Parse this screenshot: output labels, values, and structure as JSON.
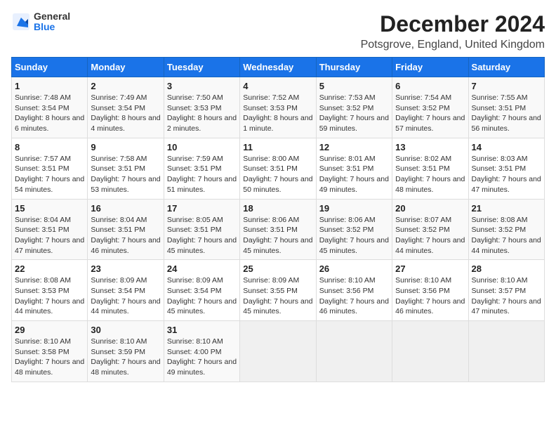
{
  "logo": {
    "general": "General",
    "blue": "Blue"
  },
  "header": {
    "title": "December 2024",
    "subtitle": "Potsgrove, England, United Kingdom"
  },
  "days_of_week": [
    "Sunday",
    "Monday",
    "Tuesday",
    "Wednesday",
    "Thursday",
    "Friday",
    "Saturday"
  ],
  "weeks": [
    [
      {
        "day": "1",
        "sunrise": "7:48 AM",
        "sunset": "3:54 PM",
        "daylight": "8 hours and 6 minutes."
      },
      {
        "day": "2",
        "sunrise": "7:49 AM",
        "sunset": "3:54 PM",
        "daylight": "8 hours and 4 minutes."
      },
      {
        "day": "3",
        "sunrise": "7:50 AM",
        "sunset": "3:53 PM",
        "daylight": "8 hours and 2 minutes."
      },
      {
        "day": "4",
        "sunrise": "7:52 AM",
        "sunset": "3:53 PM",
        "daylight": "8 hours and 1 minute."
      },
      {
        "day": "5",
        "sunrise": "7:53 AM",
        "sunset": "3:52 PM",
        "daylight": "7 hours and 59 minutes."
      },
      {
        "day": "6",
        "sunrise": "7:54 AM",
        "sunset": "3:52 PM",
        "daylight": "7 hours and 57 minutes."
      },
      {
        "day": "7",
        "sunrise": "7:55 AM",
        "sunset": "3:51 PM",
        "daylight": "7 hours and 56 minutes."
      }
    ],
    [
      {
        "day": "8",
        "sunrise": "7:57 AM",
        "sunset": "3:51 PM",
        "daylight": "7 hours and 54 minutes."
      },
      {
        "day": "9",
        "sunrise": "7:58 AM",
        "sunset": "3:51 PM",
        "daylight": "7 hours and 53 minutes."
      },
      {
        "day": "10",
        "sunrise": "7:59 AM",
        "sunset": "3:51 PM",
        "daylight": "7 hours and 51 minutes."
      },
      {
        "day": "11",
        "sunrise": "8:00 AM",
        "sunset": "3:51 PM",
        "daylight": "7 hours and 50 minutes."
      },
      {
        "day": "12",
        "sunrise": "8:01 AM",
        "sunset": "3:51 PM",
        "daylight": "7 hours and 49 minutes."
      },
      {
        "day": "13",
        "sunrise": "8:02 AM",
        "sunset": "3:51 PM",
        "daylight": "7 hours and 48 minutes."
      },
      {
        "day": "14",
        "sunrise": "8:03 AM",
        "sunset": "3:51 PM",
        "daylight": "7 hours and 47 minutes."
      }
    ],
    [
      {
        "day": "15",
        "sunrise": "8:04 AM",
        "sunset": "3:51 PM",
        "daylight": "7 hours and 47 minutes."
      },
      {
        "day": "16",
        "sunrise": "8:04 AM",
        "sunset": "3:51 PM",
        "daylight": "7 hours and 46 minutes."
      },
      {
        "day": "17",
        "sunrise": "8:05 AM",
        "sunset": "3:51 PM",
        "daylight": "7 hours and 45 minutes."
      },
      {
        "day": "18",
        "sunrise": "8:06 AM",
        "sunset": "3:51 PM",
        "daylight": "7 hours and 45 minutes."
      },
      {
        "day": "19",
        "sunrise": "8:06 AM",
        "sunset": "3:52 PM",
        "daylight": "7 hours and 45 minutes."
      },
      {
        "day": "20",
        "sunrise": "8:07 AM",
        "sunset": "3:52 PM",
        "daylight": "7 hours and 44 minutes."
      },
      {
        "day": "21",
        "sunrise": "8:08 AM",
        "sunset": "3:52 PM",
        "daylight": "7 hours and 44 minutes."
      }
    ],
    [
      {
        "day": "22",
        "sunrise": "8:08 AM",
        "sunset": "3:53 PM",
        "daylight": "7 hours and 44 minutes."
      },
      {
        "day": "23",
        "sunrise": "8:09 AM",
        "sunset": "3:54 PM",
        "daylight": "7 hours and 44 minutes."
      },
      {
        "day": "24",
        "sunrise": "8:09 AM",
        "sunset": "3:54 PM",
        "daylight": "7 hours and 45 minutes."
      },
      {
        "day": "25",
        "sunrise": "8:09 AM",
        "sunset": "3:55 PM",
        "daylight": "7 hours and 45 minutes."
      },
      {
        "day": "26",
        "sunrise": "8:10 AM",
        "sunset": "3:56 PM",
        "daylight": "7 hours and 46 minutes."
      },
      {
        "day": "27",
        "sunrise": "8:10 AM",
        "sunset": "3:56 PM",
        "daylight": "7 hours and 46 minutes."
      },
      {
        "day": "28",
        "sunrise": "8:10 AM",
        "sunset": "3:57 PM",
        "daylight": "7 hours and 47 minutes."
      }
    ],
    [
      {
        "day": "29",
        "sunrise": "8:10 AM",
        "sunset": "3:58 PM",
        "daylight": "7 hours and 48 minutes."
      },
      {
        "day": "30",
        "sunrise": "8:10 AM",
        "sunset": "3:59 PM",
        "daylight": "7 hours and 48 minutes."
      },
      {
        "day": "31",
        "sunrise": "8:10 AM",
        "sunset": "4:00 PM",
        "daylight": "7 hours and 49 minutes."
      },
      null,
      null,
      null,
      null
    ]
  ],
  "labels": {
    "sunrise": "Sunrise:",
    "sunset": "Sunset:",
    "daylight": "Daylight:"
  }
}
